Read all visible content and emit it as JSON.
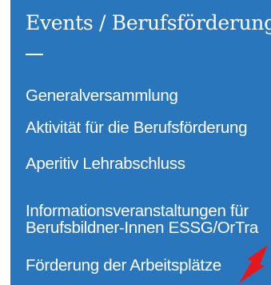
{
  "panel": {
    "title": "Events / Berufsförderung",
    "background_color": "#2a76bd",
    "text_color": "#ffffff"
  },
  "menu": {
    "items": [
      {
        "label": "Generalversammlung"
      },
      {
        "label": "Aktivität für die Berufsförderung"
      },
      {
        "label": "Aperitiv Lehrabschluss"
      },
      {
        "label_line1": "Informationsveranstaltungen für",
        "label_line2": "Berufsbildner-Innen ESSG/OrTra"
      },
      {
        "label": "Förderung der Arbeitsplätze"
      }
    ]
  },
  "annotation": {
    "icon": "red-arrow-icon",
    "color": "#e8161b"
  }
}
